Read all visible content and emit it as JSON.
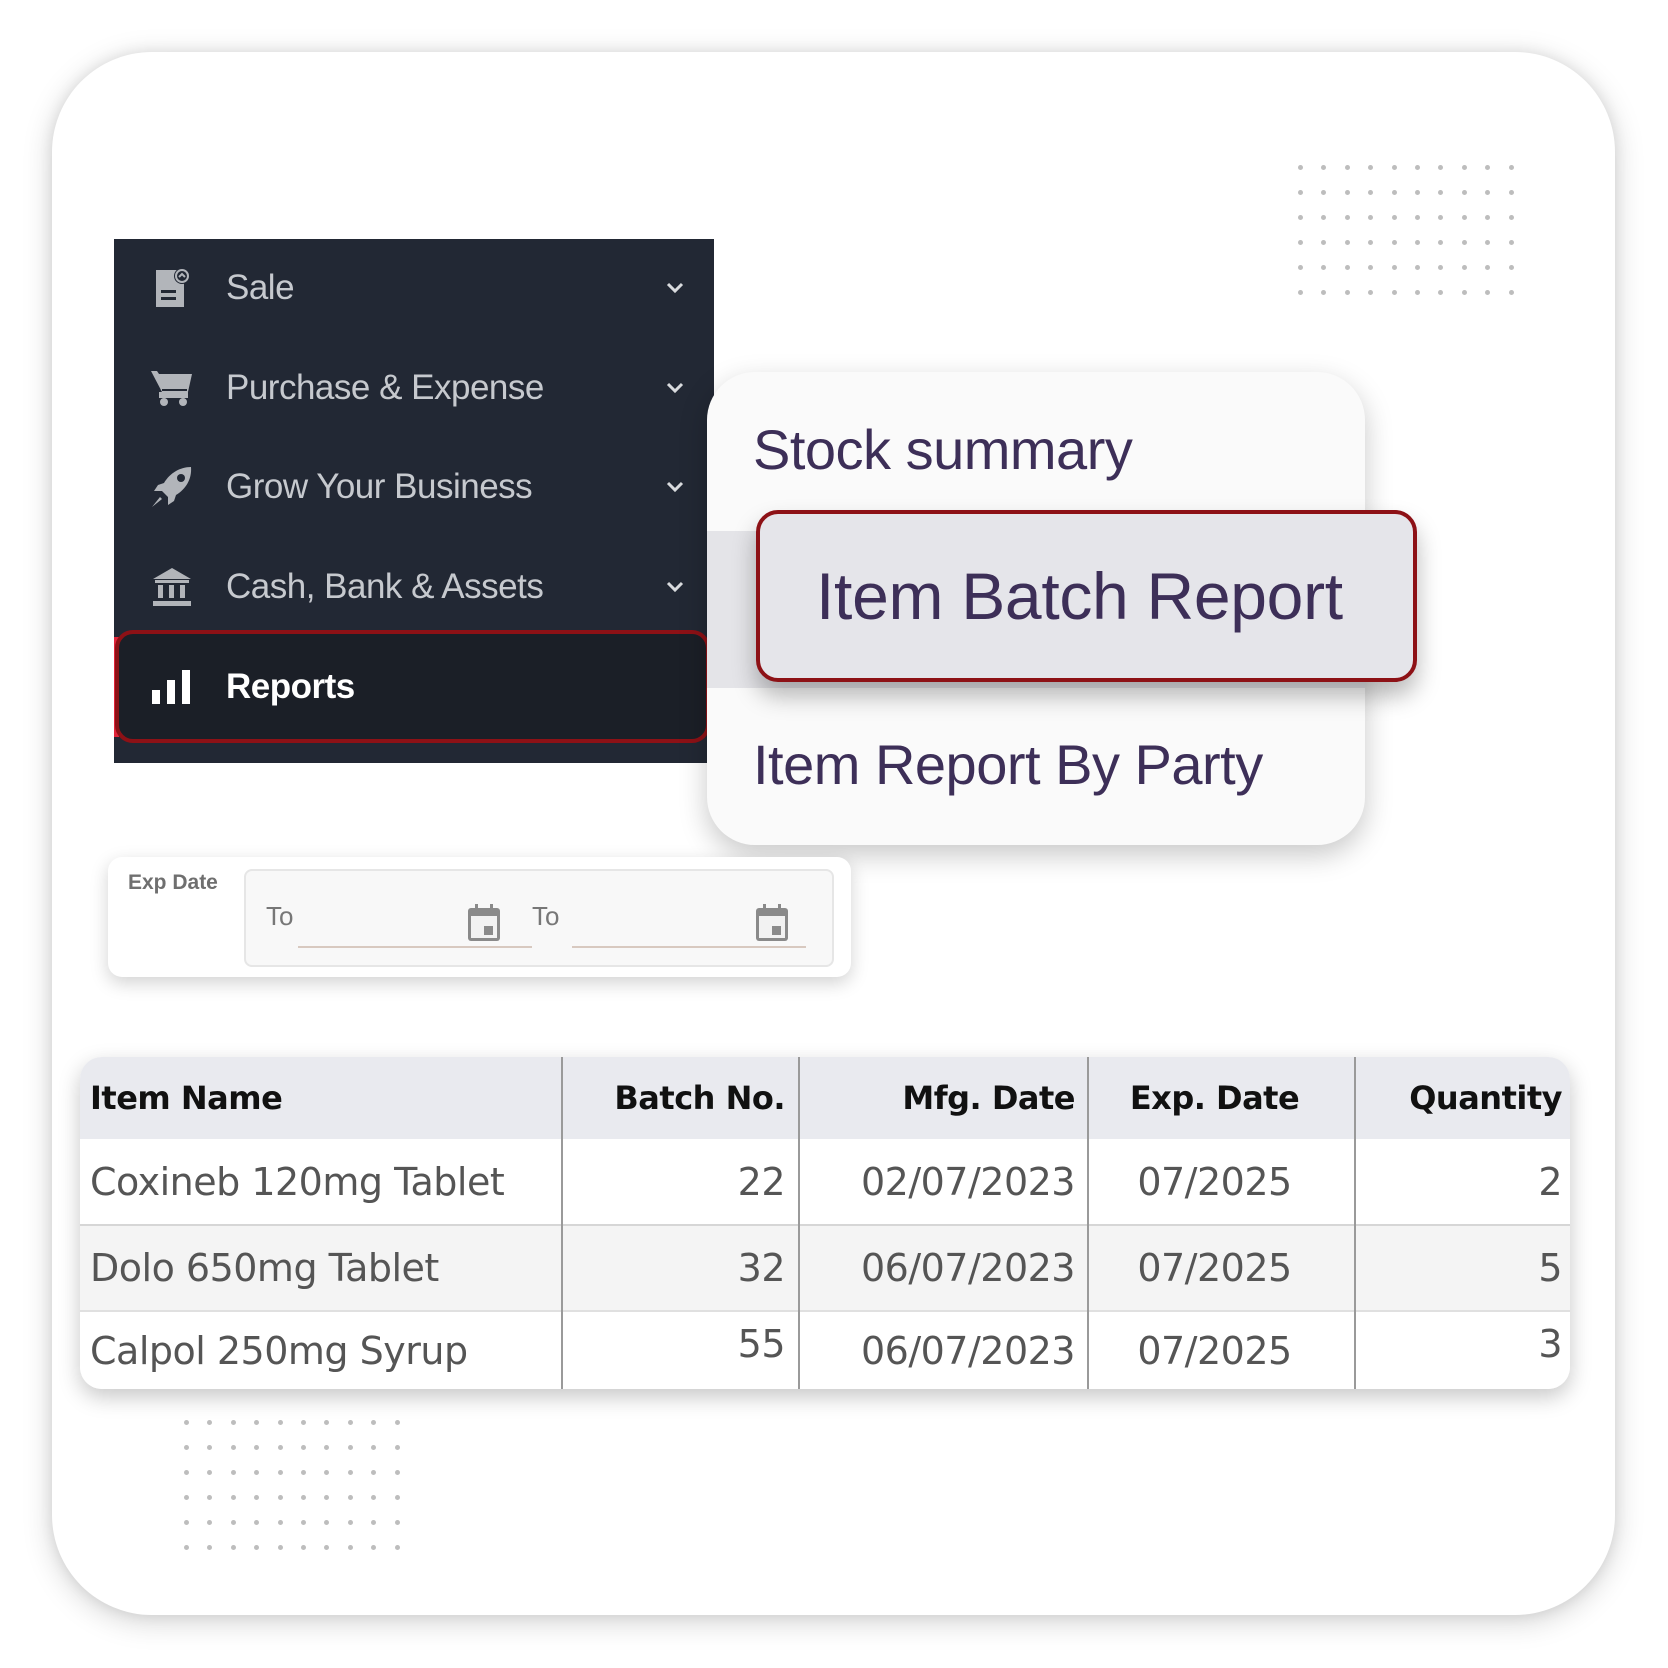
{
  "sidebar": {
    "items": [
      {
        "label": "Sale",
        "icon": "invoice-icon",
        "expandable": true
      },
      {
        "label": "Purchase & Expense",
        "icon": "cart-icon",
        "expandable": true
      },
      {
        "label": "Grow Your Business",
        "icon": "rocket-icon",
        "expandable": true
      },
      {
        "label": "Cash, Bank & Assets",
        "icon": "bank-icon",
        "expandable": true
      },
      {
        "label": "Reports",
        "icon": "bar-chart-icon",
        "expandable": false,
        "active": true
      }
    ]
  },
  "reports_menu": {
    "items": [
      {
        "label": "Stock summary"
      },
      {
        "label": "Item Batch Report",
        "highlighted": true
      },
      {
        "label": "Item Report By Party"
      }
    ]
  },
  "exp_date_filter": {
    "title": "Exp Date",
    "from_label": "To",
    "to_label": "To",
    "from_value": "",
    "to_value": ""
  },
  "table": {
    "columns": [
      "Item Name",
      "Batch No.",
      "Mfg. Date",
      "Exp. Date",
      "Quantity"
    ],
    "rows": [
      [
        "Coxineb 120mg Tablet",
        "22",
        "02/07/2023",
        "07/2025",
        "2"
      ],
      [
        "Dolo 650mg Tablet",
        "32",
        "06/07/2023",
        "07/2025",
        "5"
      ],
      [
        "Calpol 250mg Syrup",
        "55",
        "06/07/2023",
        "07/2025",
        "3"
      ]
    ]
  },
  "colors": {
    "sidebar_bg": "#222834",
    "highlight_border": "#8d1116",
    "accent": "#e0243a",
    "menu_text": "#3d2f58"
  }
}
